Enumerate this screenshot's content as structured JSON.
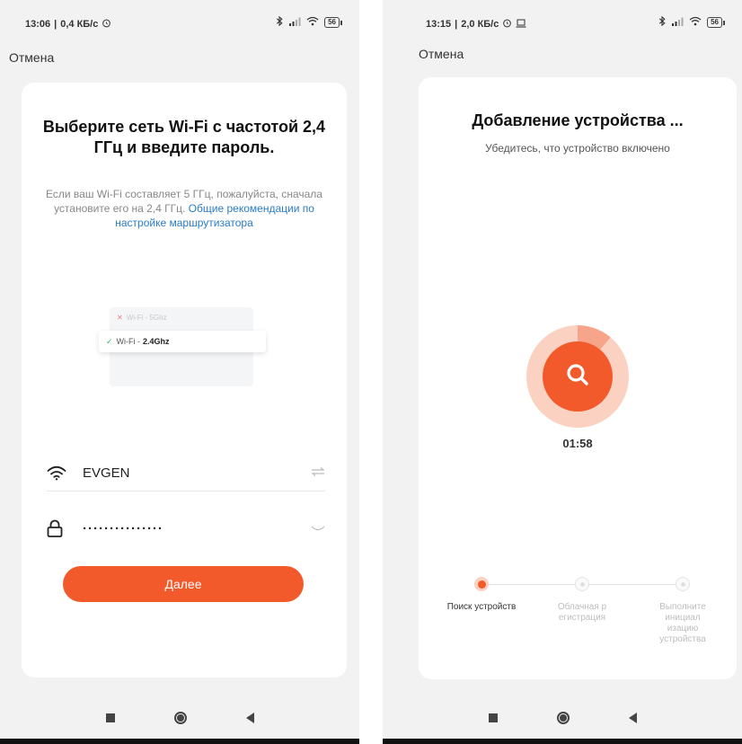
{
  "left": {
    "status": {
      "time": "13:06",
      "speed": "0,4 КБ/с",
      "battery": "56"
    },
    "cancel_label": "Отмена",
    "title": "Выберите сеть Wi-Fi с частотой 2,4 ГГц и введите пароль.",
    "hint_text": "Если ваш Wi-Fi составляет 5 ГГц, пожалуйста, сначала установите его на 2,4 ГГц.",
    "hint_link": "Общие рекомендации по настройке маршрутизатора",
    "illustration": {
      "bad_label": "Wi-Fi - 5Ghz",
      "good_prefix": "Wi-Fi -",
      "good_value": "2.4Ghz"
    },
    "ssid": "EVGEN",
    "password_mask": "···············",
    "next_label": "Далее"
  },
  "right": {
    "status": {
      "time": "13:15",
      "speed": "2,0 КБ/с",
      "battery": "56"
    },
    "cancel_label": "Отмена",
    "title": "Добавление устройства ...",
    "subtitle": "Убедитесь, что устройство включено",
    "timer": "01:58",
    "steps": [
      {
        "label": "Поиск устройств",
        "state": "active"
      },
      {
        "label": "Облачная р егистрация",
        "state": "idle"
      },
      {
        "label": "Выполните инициал изацию устройства",
        "state": "idle"
      }
    ]
  },
  "colors": {
    "accent": "#f35a2b",
    "accent_light": "#fbd1c2",
    "link": "#2a7cc7"
  }
}
